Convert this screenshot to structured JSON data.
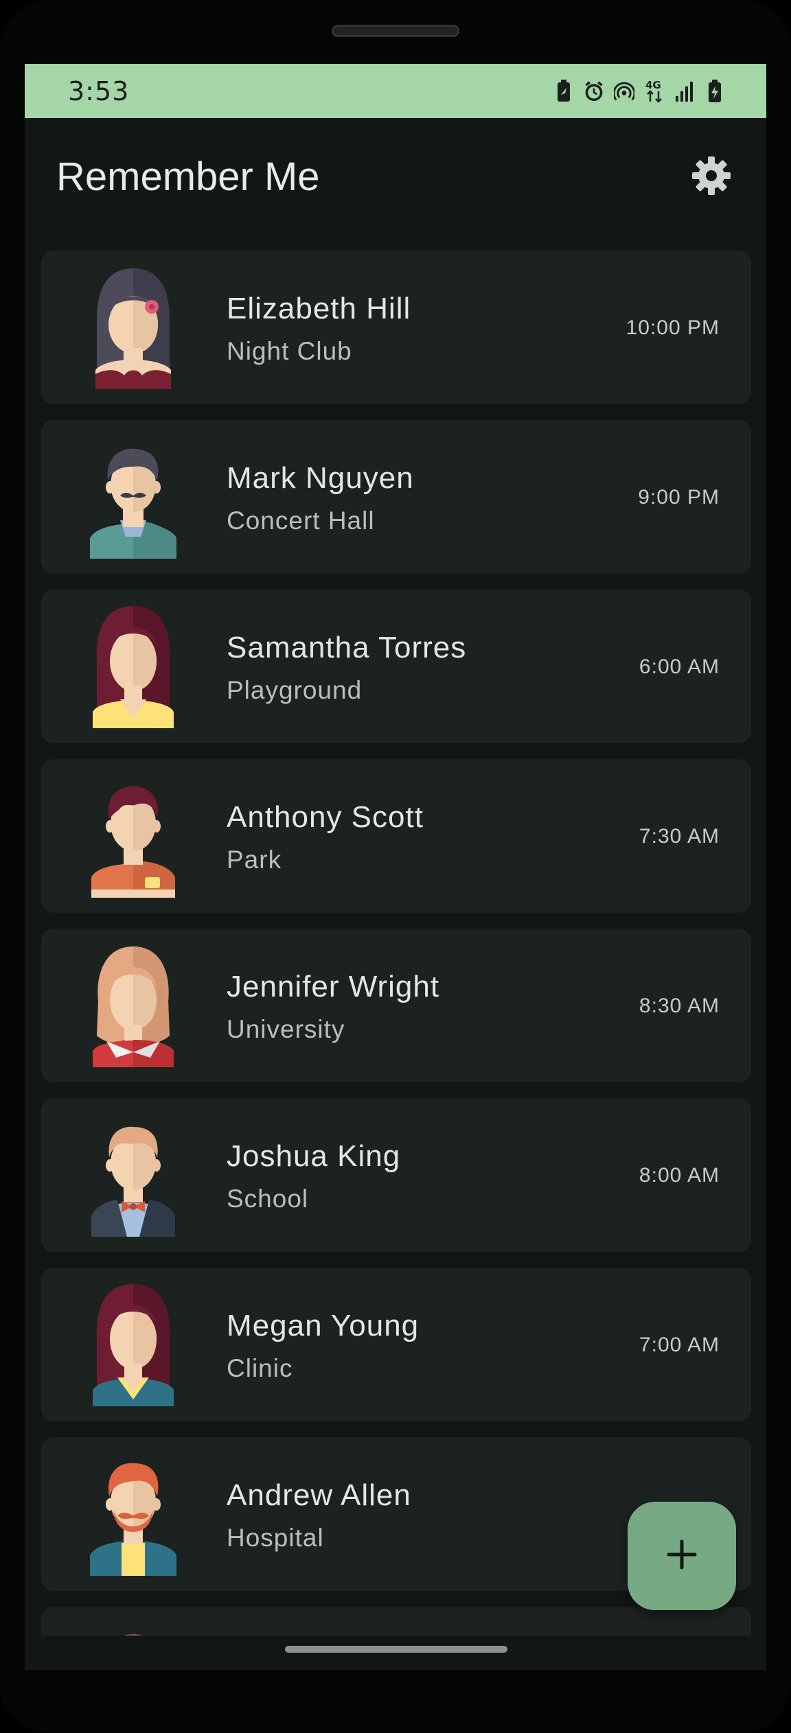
{
  "status_bar": {
    "time": "3:53",
    "icons": [
      "battery-saver-icon",
      "alarm-icon",
      "hotspot-icon",
      "network-4g-icon",
      "signal-icon",
      "battery-charging-icon"
    ],
    "network_label": "4G"
  },
  "app": {
    "title": "Remember Me",
    "settings_icon": "gear-icon"
  },
  "contacts": [
    {
      "name": "Elizabeth Hill",
      "place": "Night Club",
      "time": "10:00 PM",
      "avatar": "woman-dark-hair-flower"
    },
    {
      "name": "Mark Nguyen",
      "place": "Concert Hall",
      "time": "9:00 PM",
      "avatar": "man-mustache"
    },
    {
      "name": "Samantha Torres",
      "place": "Playground",
      "time": "6:00 AM",
      "avatar": "woman-red-hair-yellow"
    },
    {
      "name": "Anthony Scott",
      "place": "Park",
      "time": "7:30 AM",
      "avatar": "man-orange-shirt"
    },
    {
      "name": "Jennifer Wright",
      "place": "University",
      "time": "8:30 AM",
      "avatar": "woman-blonde-red-shirt"
    },
    {
      "name": "Joshua King",
      "place": "School",
      "time": "8:00 AM",
      "avatar": "man-vest-bowtie"
    },
    {
      "name": "Megan Young",
      "place": "Clinic",
      "time": "7:00 AM",
      "avatar": "woman-red-hair-teal"
    },
    {
      "name": "Andrew Allen",
      "place": "Hospital",
      "time": "",
      "avatar": "man-beard-ginger"
    }
  ],
  "fab": {
    "icon": "plus-icon"
  },
  "colors": {
    "status_bar": "#a4d6a8",
    "background": "#121614",
    "card": "#1c2220",
    "fab": "#76a984"
  }
}
